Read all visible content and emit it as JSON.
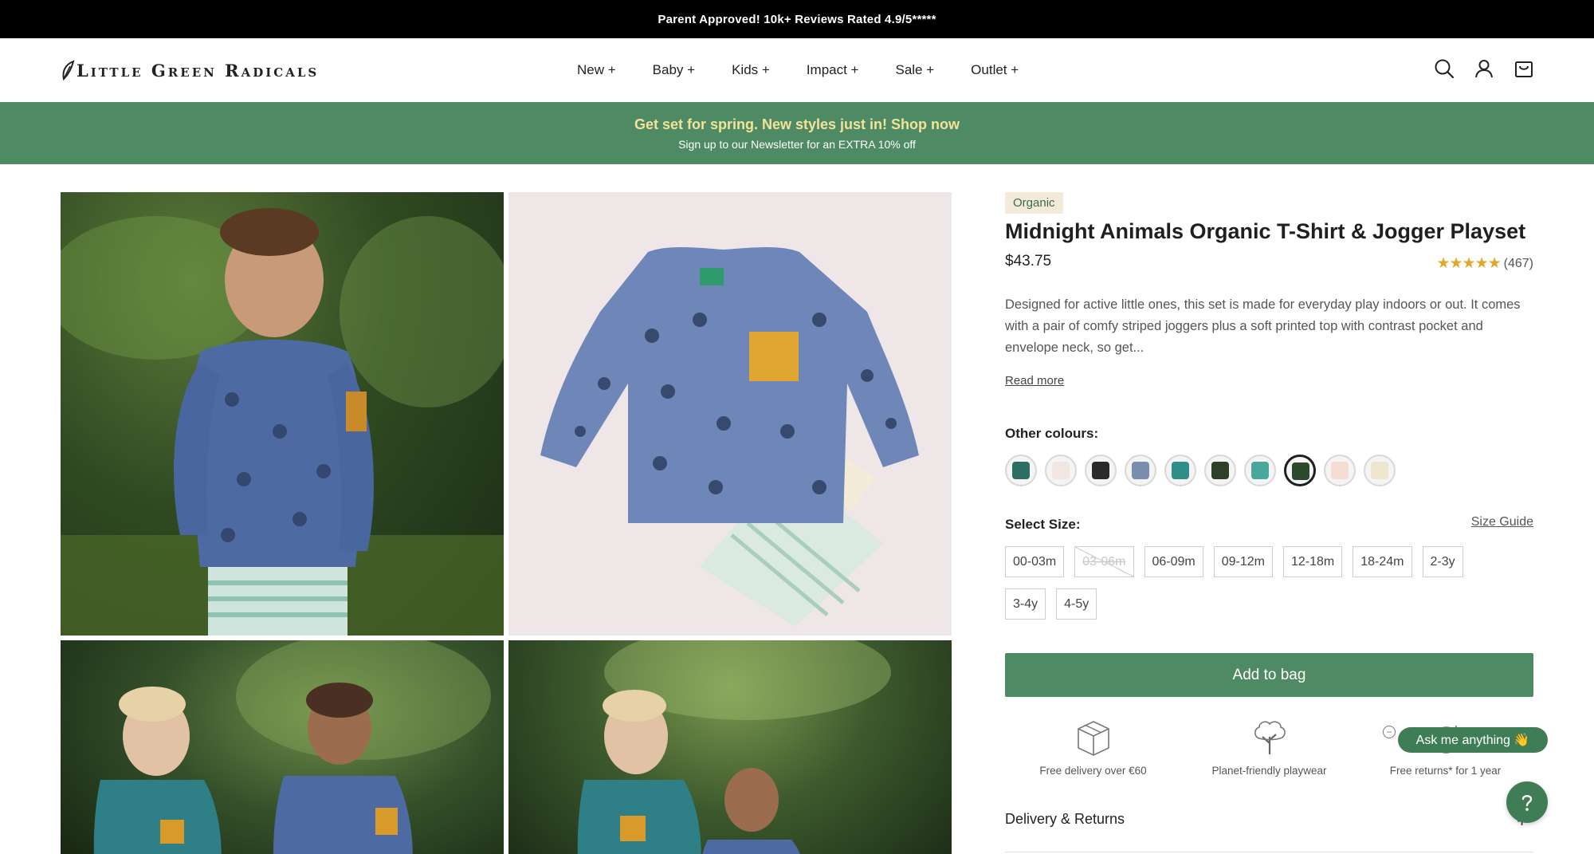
{
  "announcement": "Parent Approved! 10k+ Reviews Rated 4.9/5*****",
  "brand": "Little Green Radicals",
  "nav": [
    "New +",
    "Baby +",
    "Kids +",
    "Impact +",
    "Sale +",
    "Outlet +"
  ],
  "header_icons": [
    "search-icon",
    "account-icon",
    "bag-icon"
  ],
  "promo": {
    "main": "Get set for spring. New styles just in! Shop now",
    "sub": "Sign up to our Newsletter for an EXTRA 10% off"
  },
  "product": {
    "badge": "Organic",
    "title": "Midnight Animals Organic T-Shirt & Jogger Playset",
    "price": "$43.75",
    "stars": "★★★★★",
    "review_count": "(467)",
    "description": "Designed for active little ones, this set is made for everyday play indoors or out. It comes with a pair of comfy striped joggers plus a soft printed top with contrast pocket and envelope neck, so get...",
    "read_more": "Read more",
    "colours_label": "Other colours:",
    "colour_swatches": [
      "#2c6e62",
      "#f2e6e0",
      "#2a2a2a",
      "#7a8eb0",
      "#2f8f8a",
      "#2f4028",
      "#49a79c",
      "#2e4a2c",
      "#f5ddd4",
      "#efe6cf"
    ],
    "selected_colour_index": 7,
    "size_label": "Select Size:",
    "size_guide": "Size Guide",
    "sizes": [
      {
        "label": "00-03m",
        "available": true
      },
      {
        "label": "03-06m",
        "available": false
      },
      {
        "label": "06-09m",
        "available": true
      },
      {
        "label": "09-12m",
        "available": true
      },
      {
        "label": "12-18m",
        "available": true
      },
      {
        "label": "18-24m",
        "available": true
      },
      {
        "label": "2-3y",
        "available": true
      },
      {
        "label": "3-4y",
        "available": true
      },
      {
        "label": "4-5y",
        "available": true
      }
    ],
    "add_to_bag": "Add to bag",
    "benefits": [
      {
        "icon": "box-icon",
        "text": "Free delivery over €60"
      },
      {
        "icon": "tree-icon",
        "text": "Planet-friendly playwear"
      },
      {
        "icon": "returns-icon",
        "text": "Free returns* for 1 year"
      }
    ],
    "delivery_returns": "Delivery & Returns",
    "delivery_toggle": "+"
  },
  "chat": {
    "ask_label": "Ask me anything 👋",
    "close_symbol": "−",
    "help_symbol": "?"
  },
  "colors": {
    "brand_green": "#4e8a63",
    "promo_text": "#f2e39a",
    "star": "#e3a82b"
  }
}
